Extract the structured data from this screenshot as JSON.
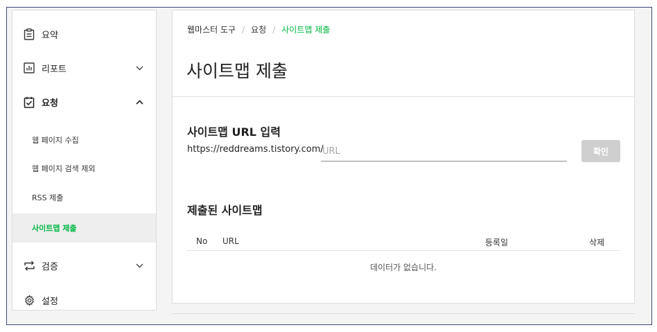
{
  "sidebar": {
    "items": [
      {
        "key": "summary",
        "label": "요약",
        "icon": "clipboard-icon",
        "chevron": null
      },
      {
        "key": "report",
        "label": "리포트",
        "icon": "bar-chart-icon",
        "chevron": "down"
      },
      {
        "key": "request",
        "label": "요청",
        "icon": "checklist-icon",
        "chevron": "up",
        "expanded": true
      },
      {
        "key": "verify",
        "label": "검증",
        "icon": "repeat-icon",
        "chevron": "down"
      },
      {
        "key": "settings",
        "label": "설정",
        "icon": "gear-icon",
        "chevron": null
      }
    ],
    "subitems": [
      {
        "label": "웹 페이지 수집"
      },
      {
        "label": "웹 페이지 검색 제외"
      },
      {
        "label": "RSS 제출"
      },
      {
        "label": "사이트맵 제출",
        "active": true
      }
    ]
  },
  "breadcrumb": [
    "웹마스터 도구",
    "요청",
    "사이트맵 제출"
  ],
  "page_title": "사이트맵 제출",
  "sitemap_form": {
    "title": "사이트맵 URL 입력",
    "url_prefix": "https://reddreams.tistory.com/",
    "input_placeholder": "URL",
    "input_value": "",
    "confirm_label": "확인"
  },
  "submitted": {
    "title": "제출된 사이트맵",
    "columns": [
      "No",
      "URL",
      "등록일",
      "삭제"
    ],
    "empty_message": "데이터가 없습니다."
  },
  "colors": {
    "accent": "#00b843",
    "frame_border": "#3d4a74",
    "button_disabled": "#cfcfcf"
  }
}
